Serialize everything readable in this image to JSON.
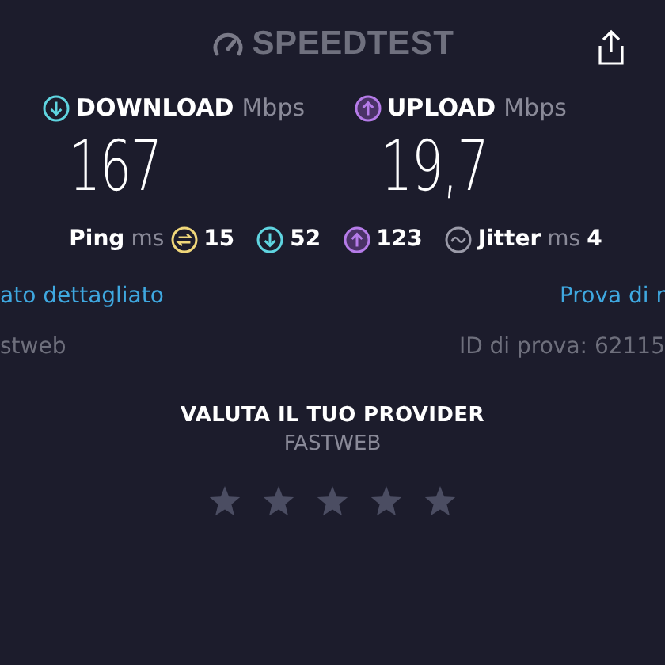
{
  "header": {
    "logo": "SPEEDTEST"
  },
  "results": [
    {
      "kind": "download",
      "label": "DOWNLOAD",
      "unit": "Mbps",
      "value": "167"
    },
    {
      "kind": "upload",
      "label": "UPLOAD",
      "unit": "Mbps",
      "value": "19,7"
    }
  ],
  "stats": [
    {
      "kind": "ping",
      "label": "Ping",
      "unit": "ms",
      "value": "15"
    },
    {
      "kind": "download",
      "value": "52"
    },
    {
      "kind": "upload",
      "value": "123"
    },
    {
      "kind": "jitter",
      "label": "Jitter",
      "unit": "ms",
      "value": "4"
    }
  ],
  "links": {
    "left": "ato dettagliato",
    "right": "Prova di r"
  },
  "info": {
    "provider": "stweb",
    "test_id": "ID di prova: 62115"
  },
  "rate": {
    "title": "VALUTA IL TUO PROVIDER",
    "provider": "FASTWEB",
    "stars": 0
  }
}
